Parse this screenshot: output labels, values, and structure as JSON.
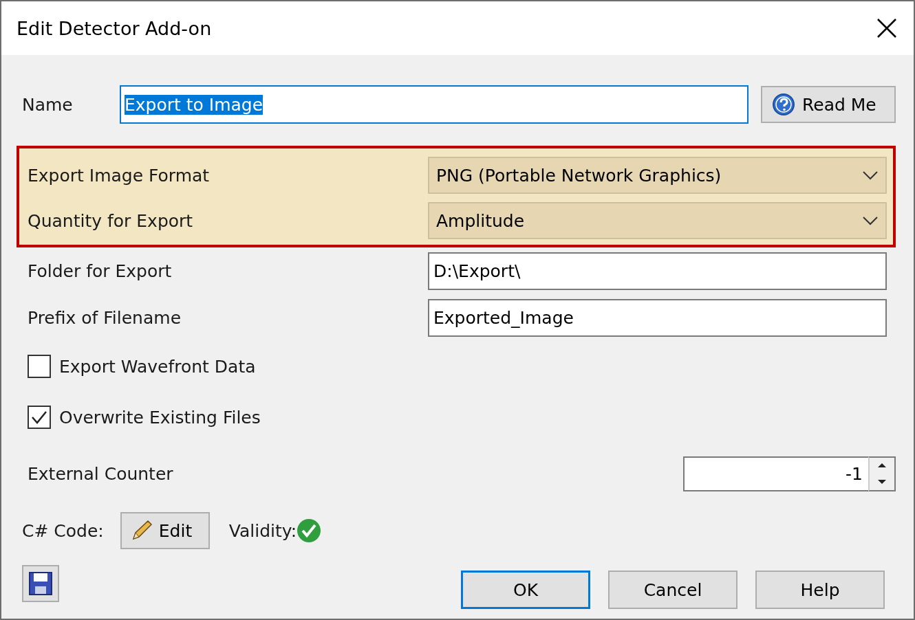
{
  "window": {
    "title": "Edit Detector Add-on"
  },
  "name_field": {
    "label": "Name",
    "value": "Export to Image",
    "text_selected": true
  },
  "read_me_button": {
    "label": "Read Me"
  },
  "highlighted_rows": [
    {
      "label": "Export Image Format",
      "kind": "dropdown",
      "value": "PNG (Portable Network Graphics)"
    },
    {
      "label": "Quantity for Export",
      "kind": "dropdown",
      "value": "Amplitude"
    }
  ],
  "rows": [
    {
      "label": "Folder for Export",
      "kind": "text",
      "value": "D:\\Export\\"
    },
    {
      "label": "Prefix of Filename",
      "kind": "text",
      "value": "Exported_Image"
    }
  ],
  "checkboxes": [
    {
      "label": "Export Wavefront Data",
      "checked": false
    },
    {
      "label": "Overwrite Existing Files",
      "checked": true
    }
  ],
  "counter": {
    "label": "External Counter",
    "value": "-1"
  },
  "code": {
    "label": "C# Code:",
    "edit_button": "Edit",
    "validity_label": "Validity:",
    "valid": true
  },
  "buttons": [
    {
      "label": "OK",
      "default": true
    },
    {
      "label": "Cancel",
      "default": false
    },
    {
      "label": "Help",
      "default": false
    }
  ]
}
